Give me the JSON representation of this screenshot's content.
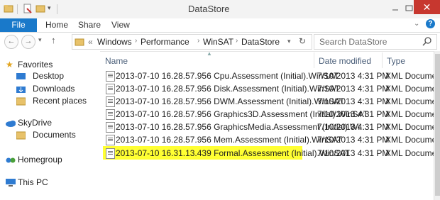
{
  "window": {
    "title": "DataStore",
    "close_label": "✕"
  },
  "ribbon": {
    "tabs": [
      "File",
      "Home",
      "Share",
      "View"
    ]
  },
  "address": {
    "prefix": "«",
    "crumbs": [
      "Windows",
      "Performance",
      "WinSAT",
      "DataStore"
    ],
    "search_placeholder": "Search DataStore"
  },
  "nav": {
    "favorites": "Favorites",
    "favorites_items": [
      "Desktop",
      "Downloads",
      "Recent places"
    ],
    "skydrive": "SkyDrive",
    "skydrive_items": [
      "Documents"
    ],
    "homegroup": "Homegroup",
    "thispc": "This PC"
  },
  "columns": {
    "name": "Name",
    "date": "Date modified",
    "type": "Type"
  },
  "files": [
    {
      "name": "2013-07-10 16.28.57.956 Cpu.Assessment (Initial).WinSAT",
      "date": "7/10/2013 4:31 PM",
      "type": "XML Document"
    },
    {
      "name": "2013-07-10 16.28.57.956 Disk.Assessment (Initial).WinSAT",
      "date": "7/10/2013 4:31 PM",
      "type": "XML Document"
    },
    {
      "name": "2013-07-10 16.28.57.956 DWM.Assessment (Initial).WinSAT",
      "date": "7/10/2013 4:31 PM",
      "type": "XML Document"
    },
    {
      "name": "2013-07-10 16.28.57.956 Graphics3D.Assessment (Initial).WinSAT",
      "date": "7/10/2013 4:31 PM",
      "type": "XML Document"
    },
    {
      "name": "2013-07-10 16.28.57.956 GraphicsMedia.Assessment (Initial).Wi...",
      "date": "7/10/2013 4:31 PM",
      "type": "XML Document"
    },
    {
      "name": "2013-07-10 16.28.57.956 Mem.Assessment (Initial).WinSAT",
      "date": "7/10/2013 4:31 PM",
      "type": "XML Document"
    },
    {
      "name": "2013-07-10 16.31.13.439 Formal.Assessment (Initial).WinSAT",
      "date": "7/10/2013 4:31 PM",
      "type": "XML Document"
    }
  ],
  "highlight_color": "#ffff33",
  "accent_color": "#1979ca"
}
